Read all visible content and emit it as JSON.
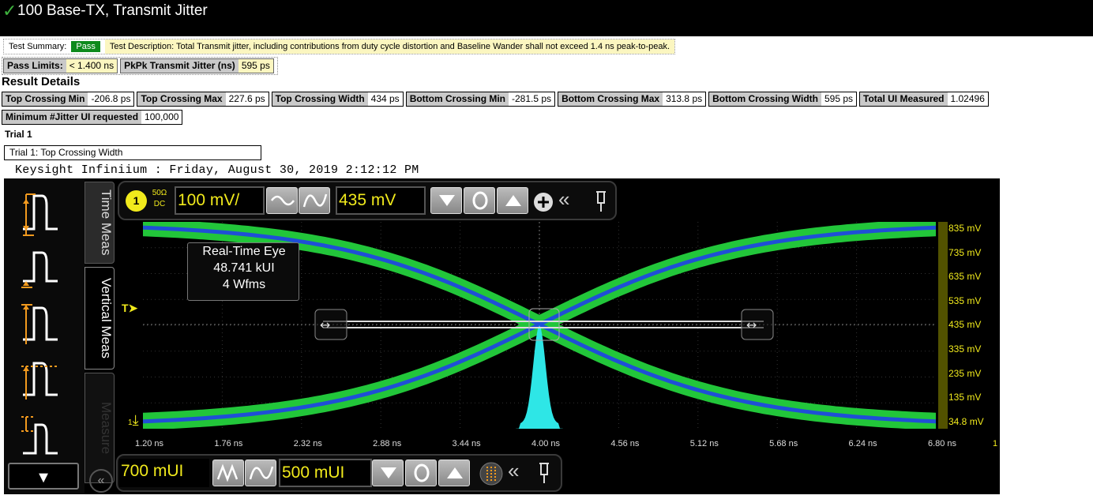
{
  "header": {
    "check": "✓",
    "title": "100 Base-TX, Transmit Jitter"
  },
  "summary": {
    "label": "Test Summary:",
    "status": "Pass",
    "description": "Test Description:     Total Transmit jitter, including contributions from duty cycle distortion and Baseline Wander shall not exceed 1.4 ns peak-to-peak."
  },
  "limits": {
    "pass_limits_label": "Pass Limits:",
    "pass_limits_value": "< 1.400 ns",
    "pkpk_label": "PkPk Transmit Jitter (ns)",
    "pkpk_value": "595 ps"
  },
  "result_details_title": "Result Details",
  "results": [
    {
      "label": "Top Crossing Min",
      "value": "-206.8 ps"
    },
    {
      "label": "Top Crossing Max",
      "value": "227.6 ps"
    },
    {
      "label": "Top Crossing Width",
      "value": "434 ps"
    },
    {
      "label": "Bottom Crossing Min",
      "value": "-281.5 ps"
    },
    {
      "label": "Bottom Crossing Max",
      "value": "313.8 ps"
    },
    {
      "label": "Bottom Crossing Width",
      "value": "595 ps"
    },
    {
      "label": "Total UI Measured",
      "value": "1.02496"
    }
  ],
  "min_jitter": {
    "label": "Minimum #Jitter UI requested",
    "value": "100,000"
  },
  "trial_label": "Trial 1",
  "trial_box": "Trial 1: Top Crossing Width",
  "scope": {
    "header": "Keysight Infiniium : Friday, August 30, 2019 2:12:12 PM",
    "tabs": {
      "time": "Time Meas",
      "vertical": "Vertical Meas",
      "measure": "Measure"
    },
    "channel": "1",
    "coupling_top": "50Ω",
    "coupling_bottom": "DC",
    "volts_per_div": "100 mV/",
    "offset": "435 mV",
    "time_per_div": "700 mUI",
    "time_position": "500 mUI",
    "annotation": [
      "Real-Time Eye",
      "48.741 kUI",
      "4 Wfms"
    ],
    "x_ticks": [
      "1.20 ns",
      "1.76 ns",
      "2.32 ns",
      "2.88 ns",
      "3.44 ns",
      "4.00 ns",
      "4.56 ns",
      "5.12 ns",
      "5.68 ns",
      "6.24 ns",
      "6.80 ns"
    ],
    "y_ticks": [
      "835 mV",
      "735 mV",
      "635 mV",
      "535 mV",
      "435 mV",
      "335 mV",
      "235 mV",
      "135 mV",
      "34.8 mV"
    ],
    "trigger_marker": "T",
    "ground_marker": "1",
    "edge_digit": "1",
    "colors": {
      "eye_outer": "#22c63a",
      "eye_inner": "#1f4fd6",
      "histogram": "#2ee6e6",
      "scale": "#f1ea1c"
    }
  }
}
